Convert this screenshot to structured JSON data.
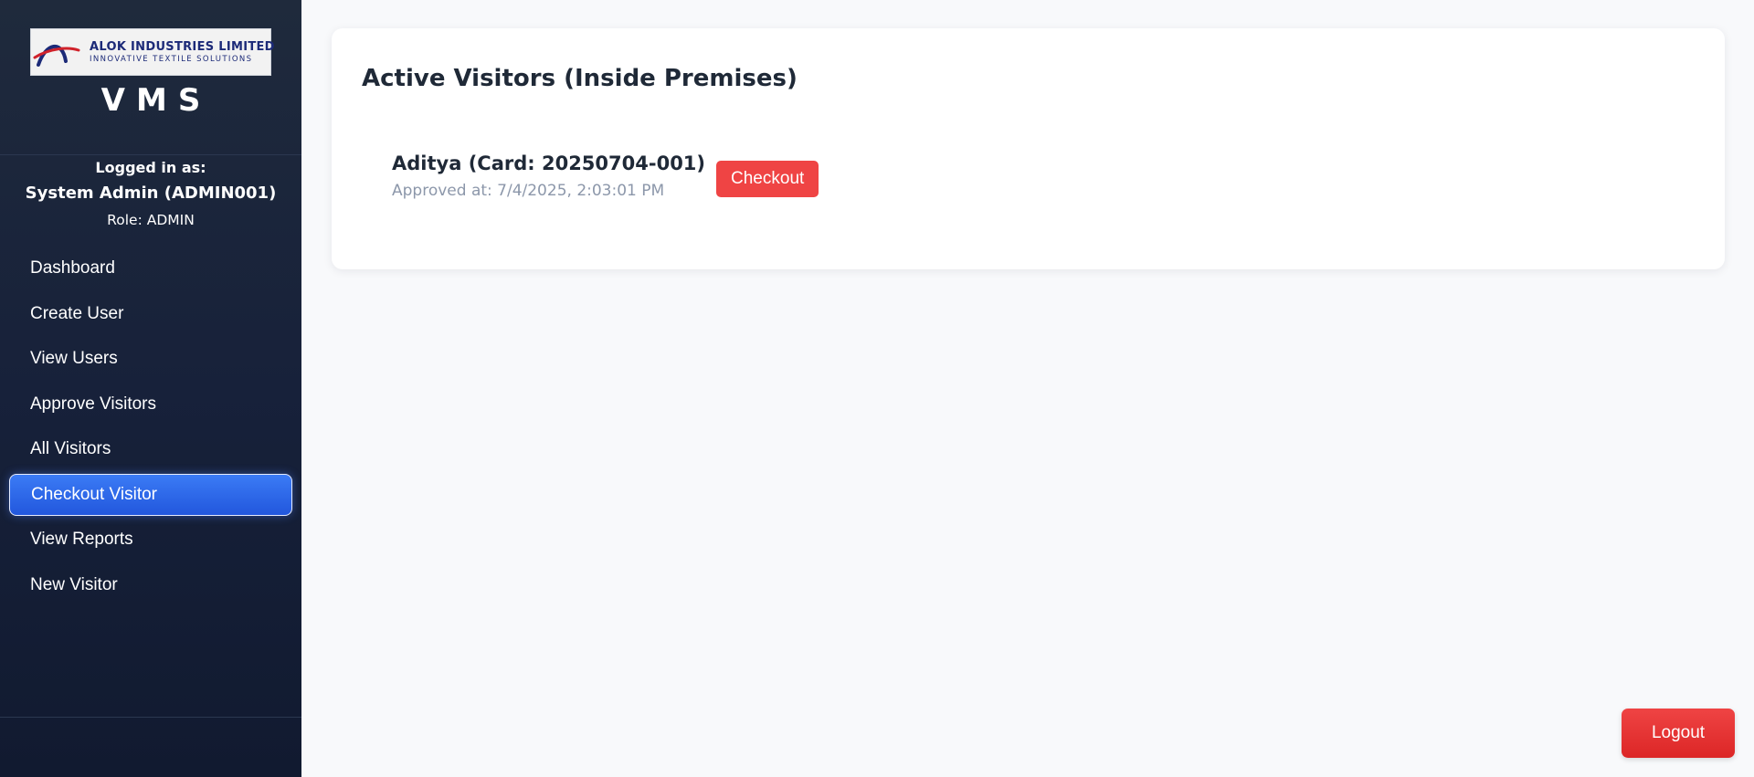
{
  "brand": {
    "company_name": "ALOK INDUSTRIES LIMITED",
    "tagline": "INNOVATIVE TEXTILE SOLUTIONS",
    "app_title": "VMS"
  },
  "user": {
    "logged_label": "Logged in as:",
    "name": "System Admin (ADMIN001)",
    "role": "Role: ADMIN"
  },
  "sidebar": {
    "items": [
      {
        "label": "Dashboard"
      },
      {
        "label": "Create User"
      },
      {
        "label": "View Users"
      },
      {
        "label": "Approve Visitors"
      },
      {
        "label": "All Visitors"
      },
      {
        "label": "Checkout Visitor",
        "active": true
      },
      {
        "label": "View Reports"
      },
      {
        "label": "New Visitor"
      }
    ]
  },
  "main": {
    "title": "Active Visitors (Inside Premises)",
    "visitors": [
      {
        "name": "Aditya (Card: 20250704-001)",
        "approved": "Approved at: 7/4/2025, 2:03:01 PM",
        "action_label": "Checkout"
      }
    ]
  },
  "logout_label": "Logout",
  "colors": {
    "sidebar_bg": "#17213a",
    "active_nav": "#2563eb",
    "danger": "#ef4444",
    "brand_blue": "#1c2a78",
    "brand_red": "#d0222b"
  },
  "icons": {
    "logo": "alok-logo-icon"
  }
}
